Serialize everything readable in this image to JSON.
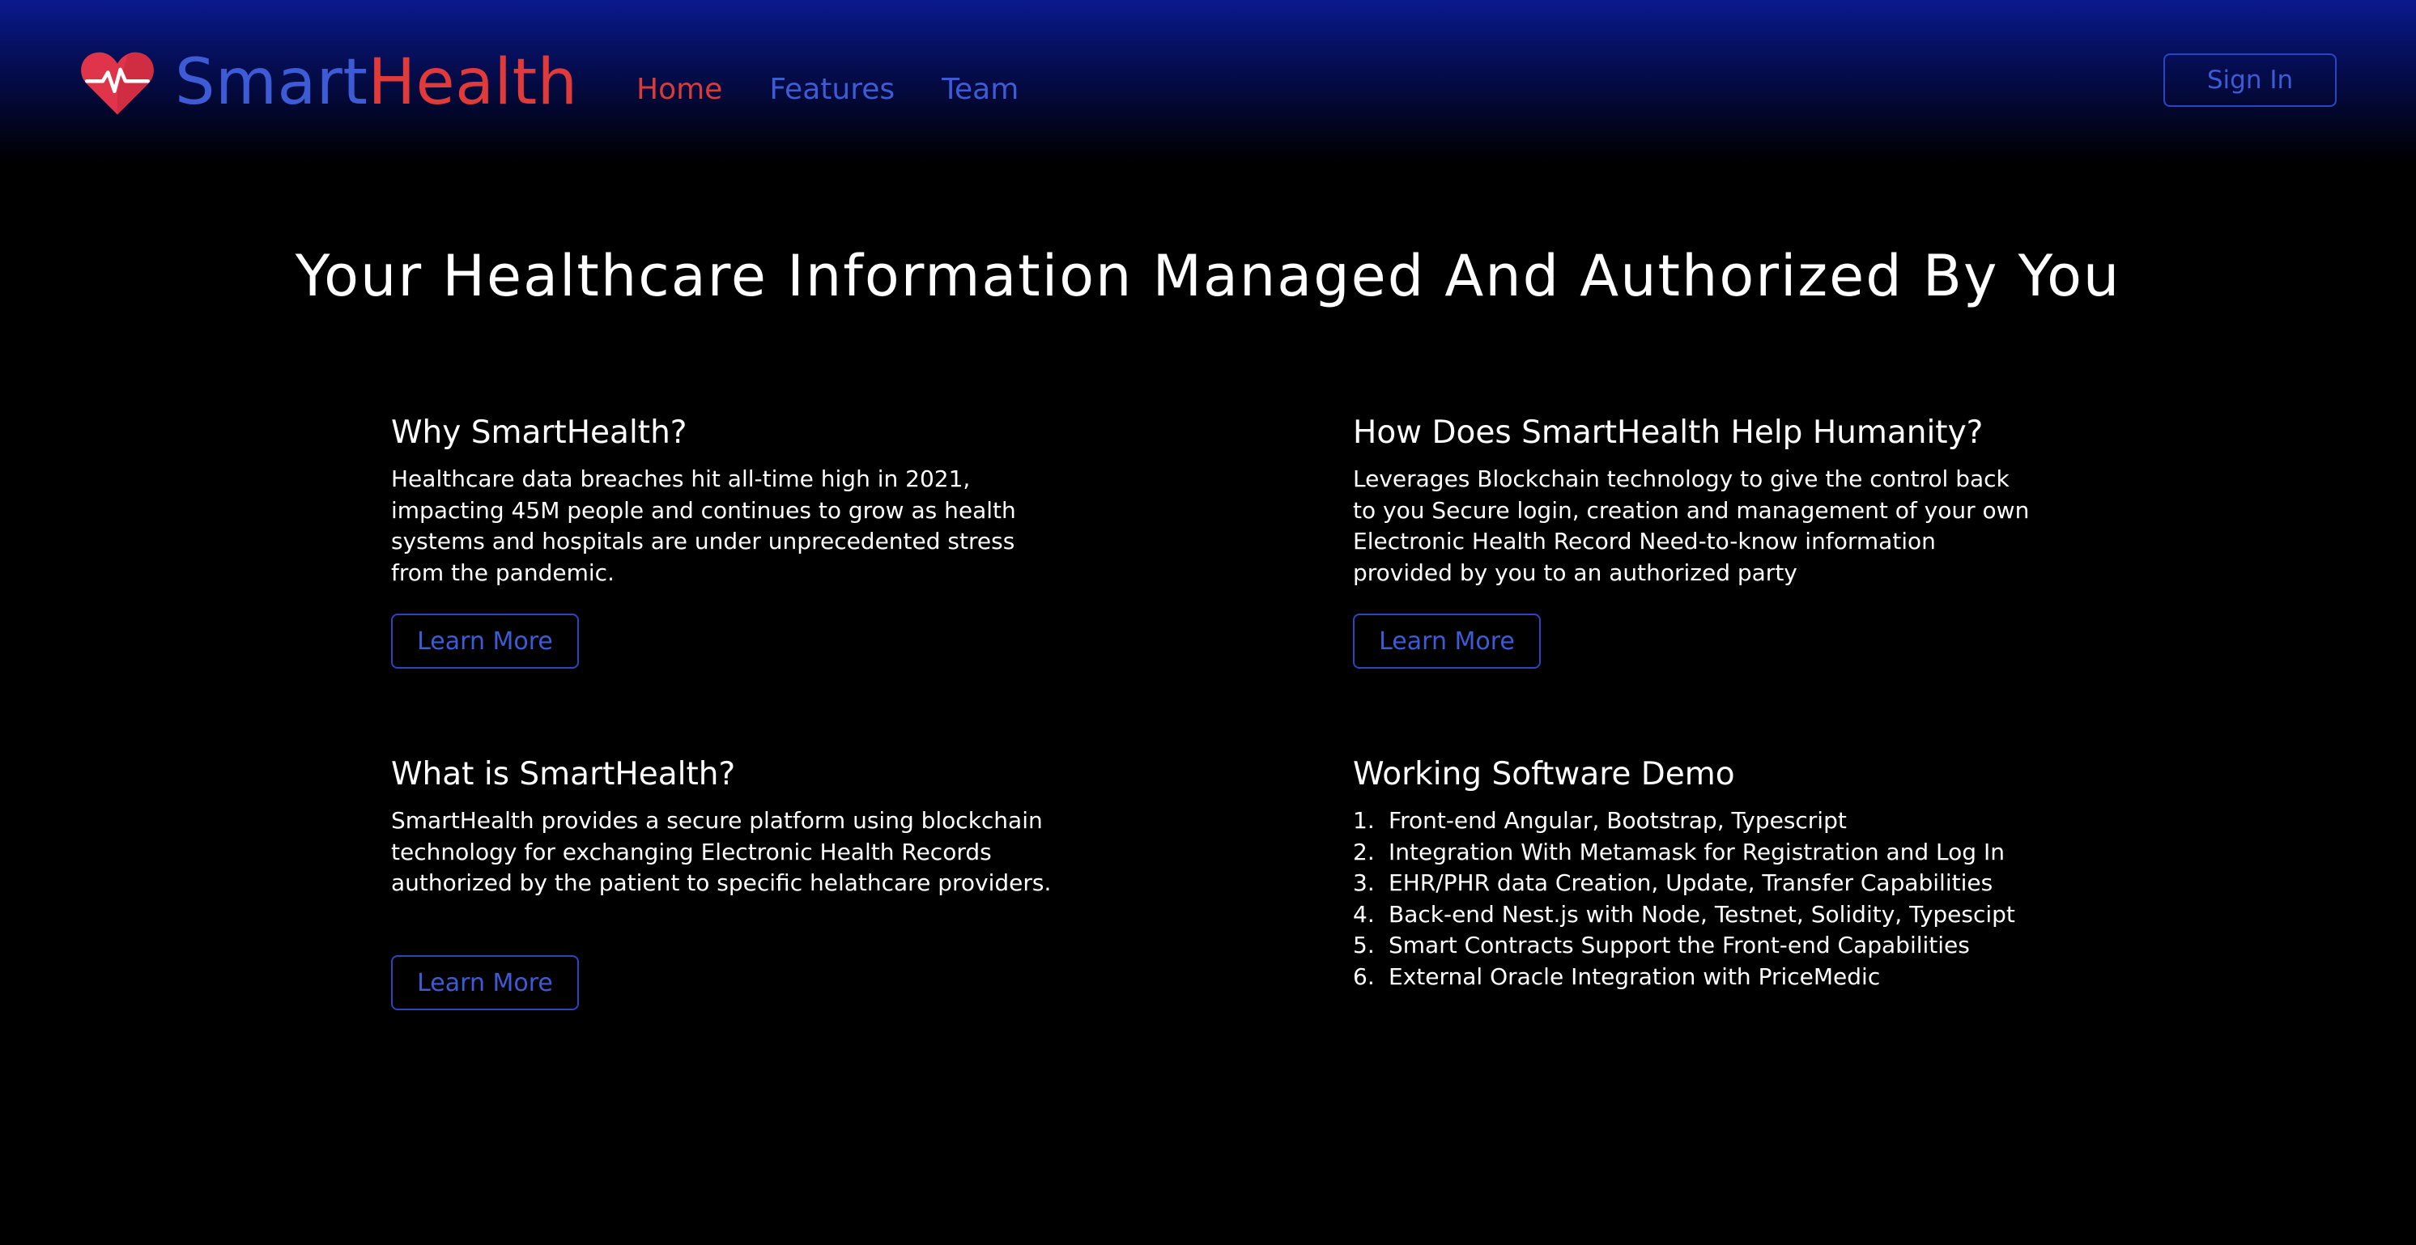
{
  "brand": {
    "part1": "Smart",
    "part2": "Health",
    "logo_icon": "heart-pulse-icon"
  },
  "nav": {
    "home": "Home",
    "features": "Features",
    "team": "Team"
  },
  "header": {
    "signin_label": "Sign In"
  },
  "hero": {
    "title": "Your Healthcare Information Managed And Authorized By You"
  },
  "cards": [
    {
      "title": "Why SmartHealth?",
      "body": "Healthcare data breaches hit all-time high in 2021, impacting 45M people and continues to grow as health systems and hospitals are under unprecedented stress from the pandemic.",
      "button": "Learn More"
    },
    {
      "title": "How Does SmartHealth Help Humanity?",
      "body": "Leverages Blockchain technology to give the control back to you Secure login, creation and management of your own Electronic Health Record Need-to-know information provided by you to an authorized party",
      "button": "Learn More"
    },
    {
      "title": "What is SmartHealth?",
      "body": "SmartHealth provides a secure platform using blockchain technology for exchanging Electronic Health Records authorized by the patient to specific helathcare providers.",
      "button": "Learn More"
    }
  ],
  "demo": {
    "title": "Working Software Demo",
    "items": [
      "Front-end Angular, Bootstrap, Typescript",
      "Integration With Metamask for Registration and Log In",
      "EHR/PHR data Creation, Update, Transfer Capabilities",
      "Back-end Nest.js with Node, Testnet, Solidity, Typescipt",
      "Smart Contracts Support the Front-end Capabilities",
      "External Oracle Integration with PriceMedic"
    ]
  },
  "colors": {
    "accent_blue": "#3e5bd6",
    "accent_red": "#e13a3a",
    "background": "#000000",
    "header_gradient_top": "#0a1a8f"
  }
}
